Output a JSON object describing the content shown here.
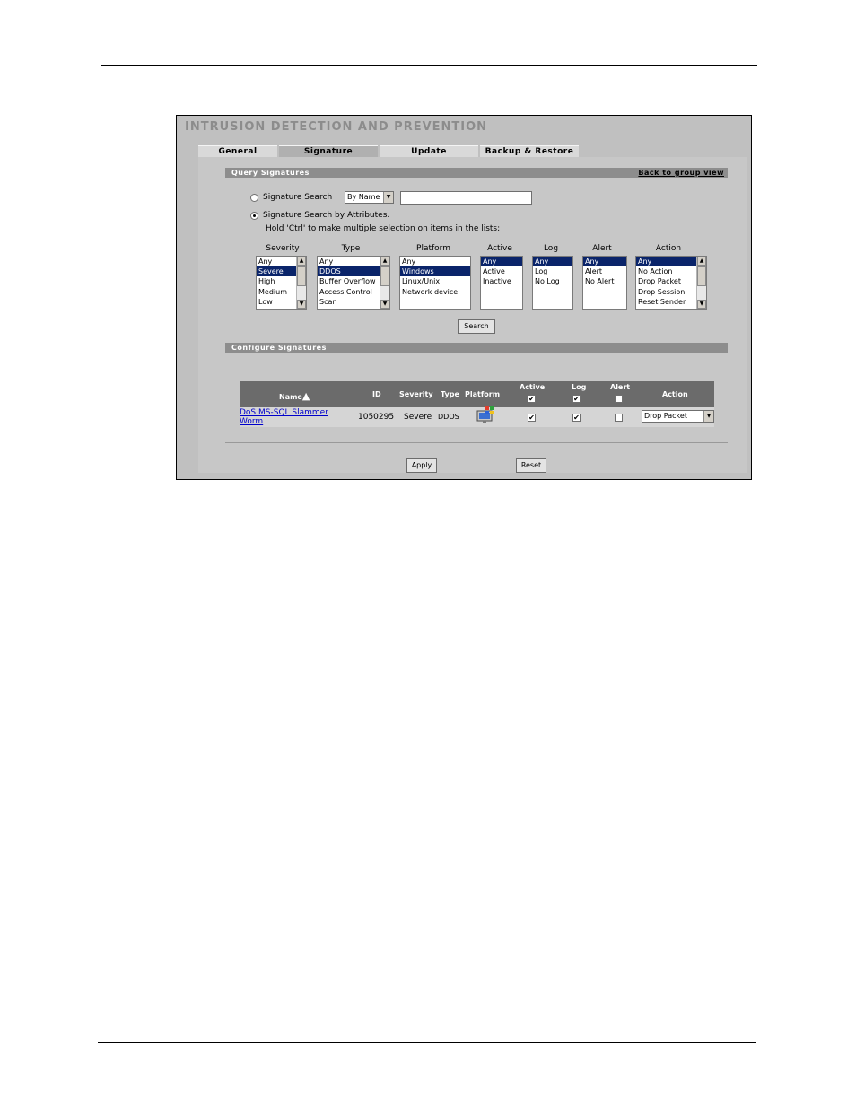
{
  "page": {
    "title": "INTRUSION DETECTION AND PREVENTION"
  },
  "tabs": [
    {
      "label": "General"
    },
    {
      "label": "Signature"
    },
    {
      "label": "Update"
    },
    {
      "label": "Backup & Restore"
    }
  ],
  "query": {
    "section_title": "Query Signatures",
    "back_link": "Back to group view",
    "search_option_label": "Signature Search",
    "search_by_value": "By Name",
    "search_input_value": "",
    "attributes_option_label": "Signature Search by Attributes.",
    "hint": "Hold 'Ctrl' to make multiple selection on items in the lists:",
    "search_button": "Search",
    "lists": {
      "severity": {
        "label": "Severity",
        "options": [
          "Any",
          "Severe",
          "High",
          "Medium",
          "Low"
        ],
        "selected": "Severe"
      },
      "type": {
        "label": "Type",
        "options": [
          "Any",
          "DDOS",
          "Buffer Overflow",
          "Access Control",
          "Scan"
        ],
        "selected": "DDOS"
      },
      "platform": {
        "label": "Platform",
        "options": [
          "Any",
          "Windows",
          "Linux/Unix",
          "Network device"
        ],
        "selected": "Windows"
      },
      "active": {
        "label": "Active",
        "options": [
          "Any",
          "Active",
          "Inactive"
        ],
        "selected": "Any"
      },
      "log": {
        "label": "Log",
        "options": [
          "Any",
          "Log",
          "No Log"
        ],
        "selected": "Any"
      },
      "alert": {
        "label": "Alert",
        "options": [
          "Any",
          "Alert",
          "No Alert"
        ],
        "selected": "Any"
      },
      "action": {
        "label": "Action",
        "options": [
          "Any",
          "No Action",
          "Drop Packet",
          "Drop Session",
          "Reset Sender"
        ],
        "selected": "Any"
      }
    }
  },
  "configure": {
    "section_title": "Configure Signatures",
    "columns": {
      "name": "Name",
      "id": "ID",
      "severity": "Severity",
      "type": "Type",
      "platform": "Platform",
      "active": "Active",
      "log": "Log",
      "alert": "Alert",
      "action": "Action"
    },
    "header_checks": {
      "active": true,
      "log": true,
      "alert": false
    },
    "rows": [
      {
        "name": "DoS MS-SQL Slammer Worm",
        "id": "1050295",
        "severity": "Severe",
        "type": "DDOS",
        "platform_icon": "windows-icon",
        "active": true,
        "log": true,
        "alert": false,
        "action": "Drop Packet"
      }
    ]
  },
  "buttons": {
    "apply": "Apply",
    "reset": "Reset"
  }
}
